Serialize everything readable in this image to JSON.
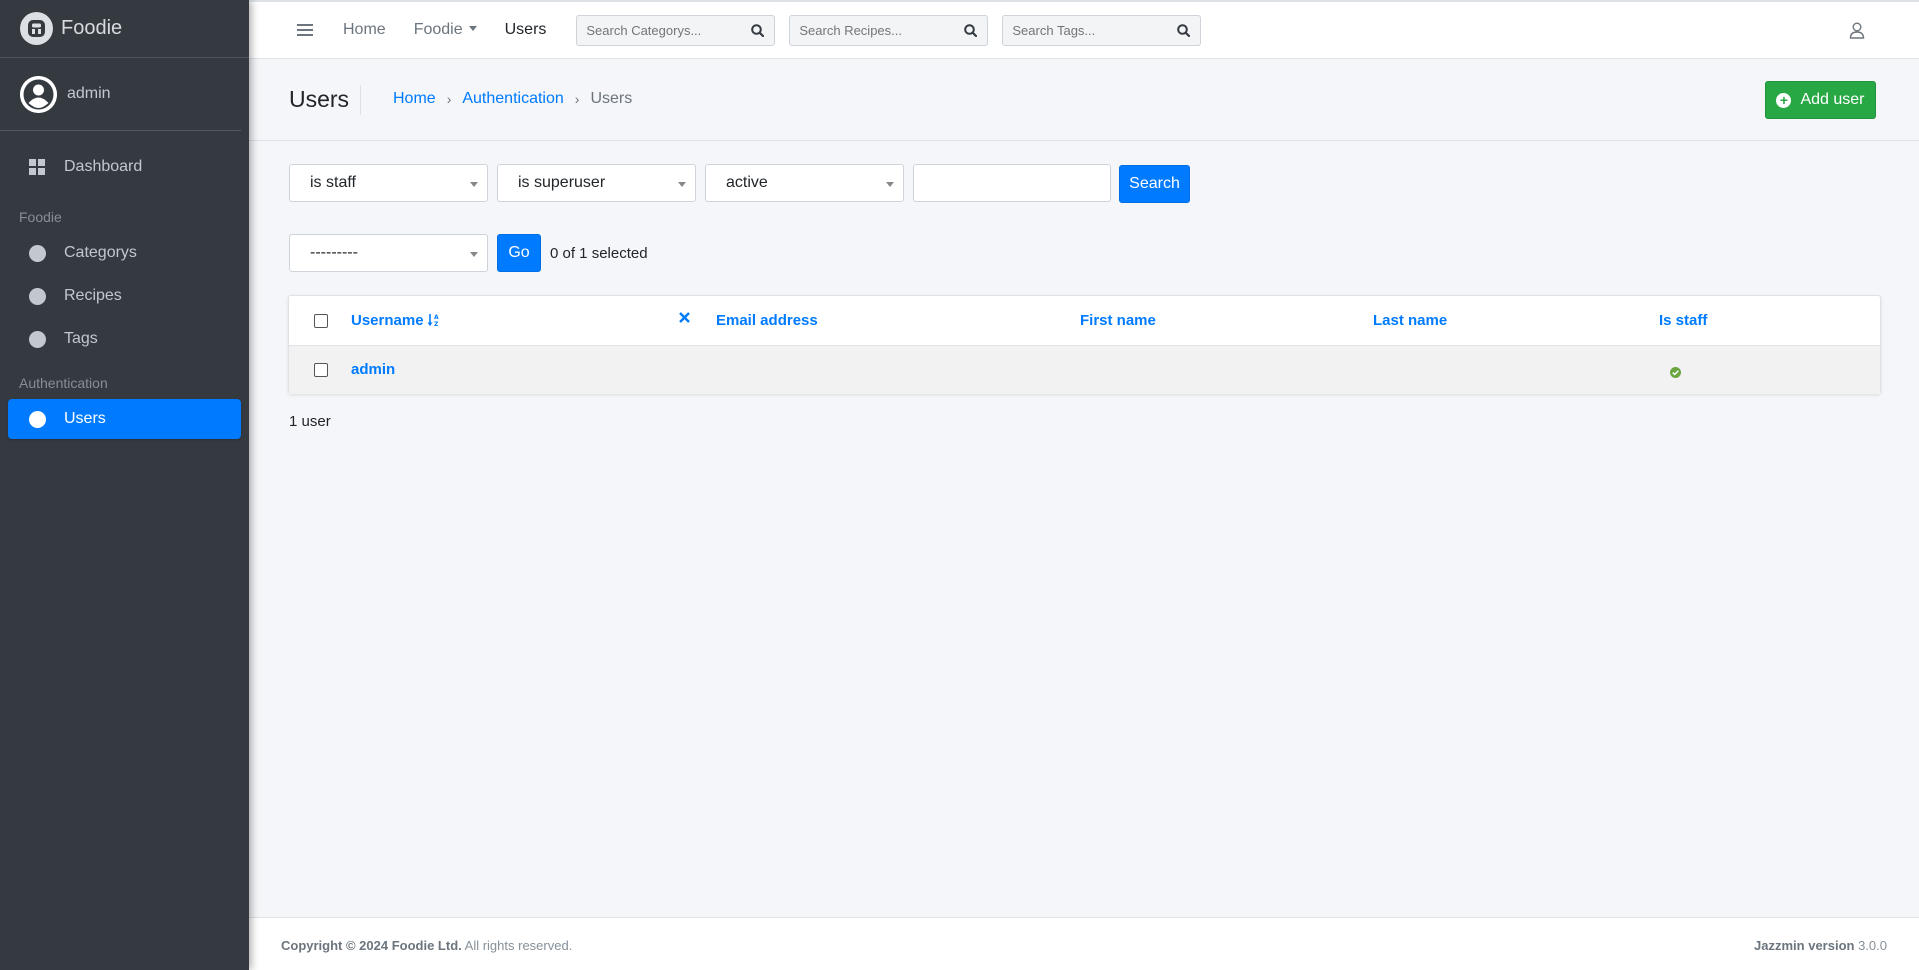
{
  "brand": {
    "name": "Foodie"
  },
  "user": {
    "name": "admin"
  },
  "sidebar": {
    "dashboard": "Dashboard",
    "section_foodie": "Foodie",
    "items_foodie": [
      "Categorys",
      "Recipes",
      "Tags"
    ],
    "section_auth": "Authentication",
    "users": "Users"
  },
  "topbar": {
    "home": "Home",
    "foodie": "Foodie",
    "users": "Users",
    "search_categorys": "Search Categorys...",
    "search_recipes": "Search Recipes...",
    "search_tags": "Search Tags..."
  },
  "header": {
    "title": "Users",
    "breadcrumb": [
      "Home",
      "Authentication",
      "Users"
    ],
    "add_button": "Add user"
  },
  "filters": {
    "is_staff": "is staff",
    "is_superuser": "is superuser",
    "active": "active",
    "search_button": "Search"
  },
  "actions": {
    "select_value": "---------",
    "go_button": "Go",
    "selected_text": "0 of 1 selected"
  },
  "table": {
    "columns": [
      "Username",
      "Email address",
      "First name",
      "Last name",
      "Is staff"
    ],
    "rows": [
      {
        "username": "admin",
        "email": "",
        "first_name": "",
        "last_name": "",
        "is_staff": true
      }
    ],
    "result_count": "1 user"
  },
  "footer": {
    "copyright_bold": "Copyright © 2024 Foodie Ltd.",
    "copyright_rest": " All rights reserved.",
    "version_label": "Jazzmin version",
    "version_number": " 3.0.0"
  },
  "colors": {
    "sidebar": "#343a40",
    "primary": "#007bff",
    "success": "#28a745"
  }
}
